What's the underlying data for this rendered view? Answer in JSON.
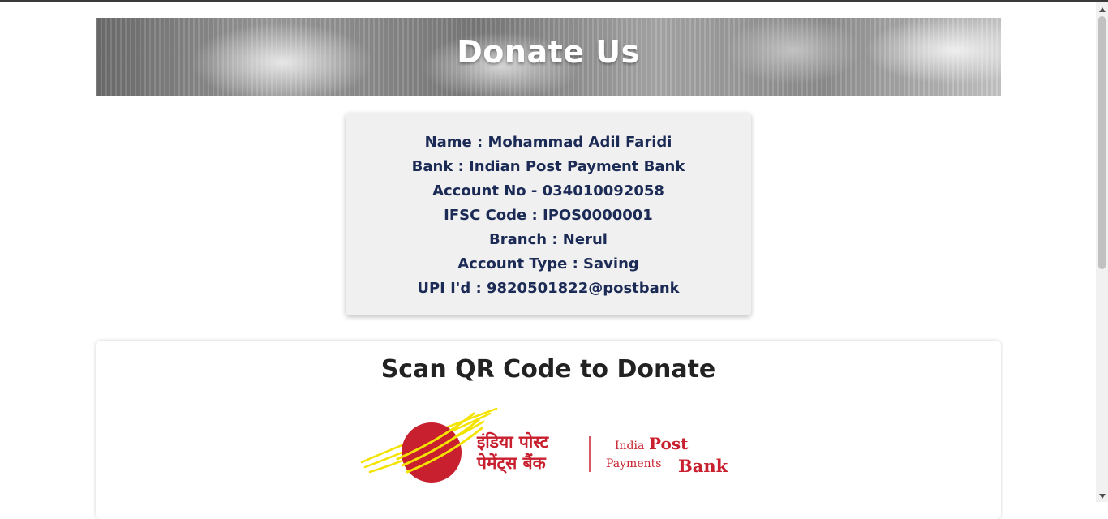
{
  "banner": {
    "title": "Donate Us"
  },
  "bank_details": {
    "lines": [
      "Name : Mohammad Adil Faridi",
      "Bank : Indian Post Payment Bank",
      "Account No - 034010092058",
      "IFSC Code : IPOS0000001",
      "Branch : Nerul",
      "Account Type : Saving",
      "UPI I'd : 9820501822@postbank"
    ]
  },
  "qr_section": {
    "heading": "Scan QR Code to Donate",
    "logo": {
      "hindi_line1": "इंडिया पोस्ट",
      "hindi_line2": "पेमेंट्स बैंक",
      "en_india": "India",
      "en_post": "Post",
      "en_payments": "Payments",
      "en_bank": "Bank"
    }
  },
  "colors": {
    "details_text": "#1b2b55",
    "details_bg": "#f0f0f0",
    "logo_red": "#c8202e",
    "logo_yellow": "#f4e300"
  },
  "icons": [
    "scroll-up-arrow-icon",
    "scroll-down-arrow-icon",
    "india-post-payments-bank-logo"
  ]
}
